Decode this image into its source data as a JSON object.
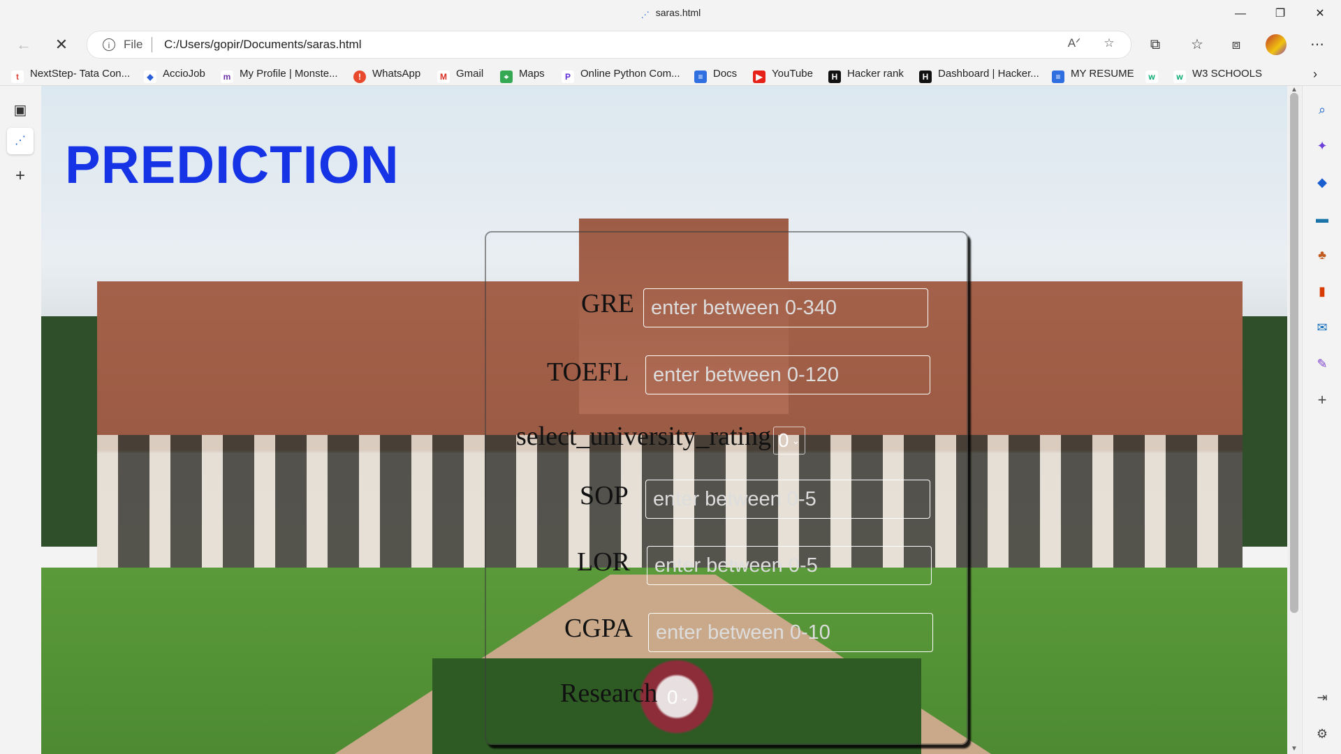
{
  "window": {
    "tab_title": "saras.html"
  },
  "address_bar": {
    "scheme_label": "File",
    "url": "C:/Users/gopir/Documents/saras.html"
  },
  "bookmarks": [
    {
      "label": "NextStep- Tata Con...",
      "icon": "tcs-icon",
      "color": "#e0453a"
    },
    {
      "label": "AccioJob",
      "icon": "acciojob-icon",
      "color": "#2b5fd9"
    },
    {
      "label": "My Profile | Monste...",
      "icon": "monster-icon",
      "color": "#6b2fa8"
    },
    {
      "label": "WhatsApp",
      "icon": "whatsapp-icon",
      "color": "#e8482c"
    },
    {
      "label": "Gmail",
      "icon": "gmail-icon",
      "color": "#d93025"
    },
    {
      "label": "Maps",
      "icon": "maps-icon",
      "color": "#34a853"
    },
    {
      "label": "Online Python Com...",
      "icon": "python-icon",
      "color": "#5b2bd8"
    },
    {
      "label": "Docs",
      "icon": "docs-icon",
      "color": "#2f6fe0"
    },
    {
      "label": "YouTube",
      "icon": "youtube-icon",
      "color": "#e62117"
    },
    {
      "label": "Hacker rank",
      "icon": "hackerrank-icon",
      "color": "#111111"
    },
    {
      "label": "Dashboard | Hacker...",
      "icon": "hackerrank-icon",
      "color": "#111111"
    },
    {
      "label": "MY RESUME",
      "icon": "docs-icon",
      "color": "#2f6fe0"
    },
    {
      "label": "",
      "icon": "w3schools-icon",
      "color": "#04aa6d"
    },
    {
      "label": "W3 SCHOOLS",
      "icon": "w3schools-icon",
      "color": "#04aa6d"
    }
  ],
  "page": {
    "title": "PREDICTION",
    "form": {
      "gre": {
        "label": "GRE",
        "placeholder": "enter between 0-340"
      },
      "toefl": {
        "label": "TOEFL",
        "placeholder": "enter between 0-120"
      },
      "university_rating": {
        "label": "select_university_rating",
        "value": "0"
      },
      "sop": {
        "label": "SOP",
        "placeholder": "enter between 0-5"
      },
      "lor": {
        "label": "LOR",
        "placeholder": "enter between 0-5"
      },
      "cgpa": {
        "label": "CGPA",
        "placeholder": "enter between 0-10"
      },
      "research": {
        "label": "Research",
        "value": "0"
      }
    }
  },
  "colors": {
    "title": "#1633e6",
    "chrome_bg": "#f3f3f3"
  }
}
